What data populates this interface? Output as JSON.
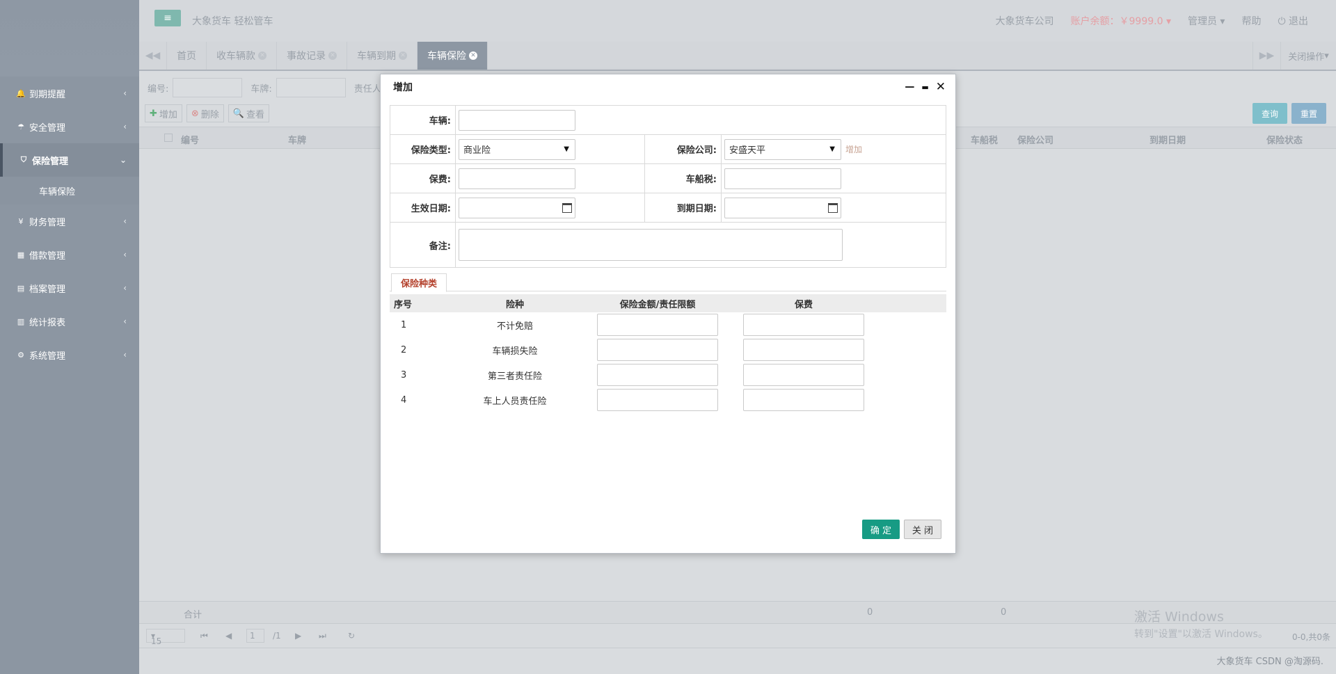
{
  "header": {
    "brand": "大象货车 轻松管车",
    "company": "大象货车公司",
    "balance": "账户余额：￥9999.0",
    "user": "管理员",
    "help": "帮助",
    "logout": "退出"
  },
  "sidebar": {
    "items": [
      {
        "label": "到期提醒",
        "icon": "bell-icon"
      },
      {
        "label": "安全管理",
        "icon": "umbrella-icon"
      },
      {
        "label": "保险管理",
        "icon": "shield-icon"
      },
      {
        "label": "财务管理",
        "icon": "yen-icon"
      },
      {
        "label": "借款管理",
        "icon": "table-icon"
      },
      {
        "label": "档案管理",
        "icon": "file-icon"
      },
      {
        "label": "统计报表",
        "icon": "chart-icon"
      },
      {
        "label": "系统管理",
        "icon": "gear-icon"
      }
    ],
    "sub_item": "车辆保险"
  },
  "tabs": {
    "items": [
      "首页",
      "收车辆款",
      "事故记录",
      "车辆到期",
      "车辆保险"
    ],
    "close_ops": "关闭操作"
  },
  "filter": {
    "no_label": "编号:",
    "plate_label": "车牌:",
    "owner_label": "责任人:"
  },
  "toolbar": {
    "add": "增加",
    "delete": "删除",
    "view": "查看",
    "query": "查询",
    "reset": "重置"
  },
  "grid": {
    "columns": [
      "编号",
      "车牌",
      "车船税",
      "保险公司",
      "到期日期",
      "保险状态"
    ],
    "footer_label": "合计",
    "footer_values": [
      "0",
      "0"
    ]
  },
  "pager": {
    "page_size": "15",
    "page": "1",
    "total_pages": "/1",
    "summary": "0-0,共0条"
  },
  "modal": {
    "title": "增加",
    "form": {
      "vehicle_label": "车辆:",
      "type_label": "保险类型:",
      "type_value": "商业险",
      "company_label": "保险公司:",
      "company_value": "安盛天平",
      "add_link": "增加",
      "fee_label": "保费:",
      "tax_label": "车船税:",
      "start_label": "生效日期:",
      "end_label": "到期日期:",
      "remark_label": "备注:"
    },
    "tab": "保险种类",
    "table": {
      "headers": [
        "序号",
        "险种",
        "保险金额/责任限额",
        "保费"
      ],
      "rows": [
        {
          "no": "1",
          "name": "不计免赔"
        },
        {
          "no": "2",
          "name": "车辆损失险"
        },
        {
          "no": "3",
          "name": "第三者责任险"
        },
        {
          "no": "4",
          "name": "车上人员责任险"
        }
      ]
    },
    "ok": "确 定",
    "close": "关 闭"
  },
  "watermark": {
    "line1": "激活 Windows",
    "line2": "转到\"设置\"以激活 Windows。"
  },
  "footer_credit": "大象货车 CSDN @淘源码."
}
